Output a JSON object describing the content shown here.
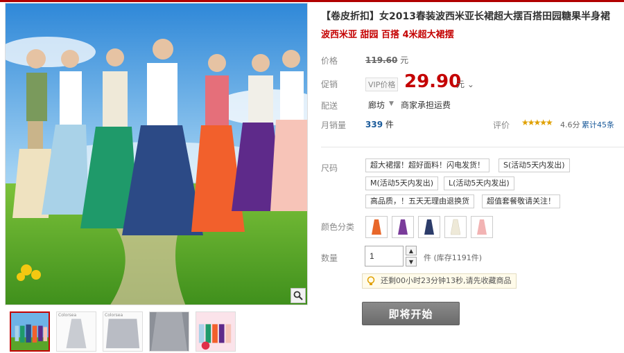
{
  "product": {
    "title": "【卷皮折扣】女2013春装波西米亚长裙超大摆百搭田园糖果半身裙",
    "subtitle": "波西米亚 甜园 百搭 4米超大裙摆"
  },
  "price": {
    "label": "价格",
    "original": "119.60",
    "unit": "元",
    "promo_label": "促销",
    "vip_tag": "VIP价格",
    "promo": "29.90",
    "promo_unit": "元"
  },
  "shipping": {
    "label": "配送",
    "from": "廊坊",
    "note": "商家承担运费"
  },
  "sales": {
    "label": "月销量",
    "count": "339",
    "count_unit": "件",
    "rating_label": "评价",
    "stars": "★★★★★",
    "score": "4.6分",
    "reviews": "累计45条"
  },
  "size": {
    "label": "尺码",
    "options": [
      "超大裙摆！超好面料！闪电发货！",
      "S(活动5天内发出)",
      "M(活动5天内发出)",
      "L(活动5天内发出)",
      "高品质，！五天无理由退换货",
      "超值套餐敬请关注！"
    ]
  },
  "color": {
    "label": "颜色分类",
    "swatches": [
      "#e8672a",
      "#7a3c9a",
      "#2c3c6a",
      "#eee9d8",
      "#f2b3b3"
    ]
  },
  "quantity": {
    "label": "数量",
    "value": "1",
    "unit_stock": "件 (库存1191件)"
  },
  "notice": "还剩00小时23分钟13秒,请先收藏商品",
  "start_button": "即将开始",
  "gallery": {
    "thumb_caption": "Colorsea"
  }
}
